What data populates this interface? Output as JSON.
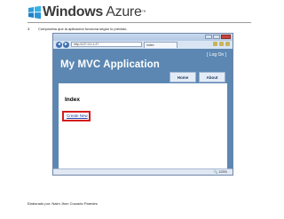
{
  "document": {
    "logo": {
      "prefix": "Windows",
      "suffix": "Azure",
      "tm": "™"
    },
    "step": {
      "number": "3.",
      "text": "Comprueba que la aplicación funciona según lo previsto."
    },
    "footer": "Elaborado por: Naim Jhon Cruzado Paredes"
  },
  "browser": {
    "address": "http://127.0.0.1:27",
    "tab_title": "Index",
    "zoom": "🔍 125%",
    "nav_back": "◄",
    "nav_forward": "►"
  },
  "app": {
    "site_title": "My MVC Application",
    "logon": "[ Log On ]",
    "menu": [
      "Home",
      "About"
    ],
    "index_heading": "Index",
    "create_link": "Create New"
  },
  "colors": {
    "header_bg": "#5c87b2",
    "highlight": "#d41d1d",
    "link": "#1a3faa"
  }
}
